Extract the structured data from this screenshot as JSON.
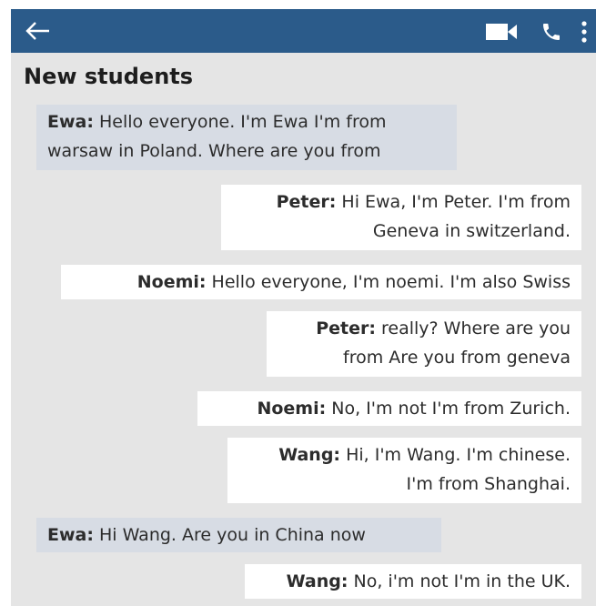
{
  "header": {
    "back_icon": "arrow-left-icon",
    "video_icon": "video-camera-icon",
    "phone_icon": "phone-icon",
    "menu_icon": "more-vertical-icon",
    "bar_color": "#2b5b8a"
  },
  "chat": {
    "title": "New students",
    "messages": [
      {
        "sender": "Ewa:",
        "lines": [
          "Hello everyone. I'm Ewa I'm from",
          "warsaw in Poland. Where are you from"
        ],
        "side": "incoming"
      },
      {
        "sender": "Peter:",
        "lines": [
          "Hi Ewa, I'm Peter. I'm from",
          "Geneva in switzerland."
        ],
        "side": "outgoing"
      },
      {
        "sender": "Noemi:",
        "lines": [
          "Hello everyone, I'm noemi. I'm also Swiss"
        ],
        "side": "outgoing"
      },
      {
        "sender": "Peter:",
        "lines": [
          "really? Where are you",
          "from Are you from geneva"
        ],
        "side": "outgoing"
      },
      {
        "sender": "Noemi:",
        "lines": [
          "No, I'm not I'm from Zurich."
        ],
        "side": "outgoing"
      },
      {
        "sender": "Wang:",
        "lines": [
          "Hi, I'm Wang. I'm chinese.",
          "I'm from Shanghai."
        ],
        "side": "outgoing"
      },
      {
        "sender": "Ewa:",
        "lines": [
          "Hi Wang. Are you in China now"
        ],
        "side": "incoming"
      },
      {
        "sender": "Wang:",
        "lines": [
          "No, i'm not I'm in the UK."
        ],
        "side": "outgoing"
      }
    ]
  },
  "colors": {
    "background": "#e5e5e5",
    "incoming_bubble": "#d7dce4",
    "outgoing_bubble": "#ffffff"
  }
}
